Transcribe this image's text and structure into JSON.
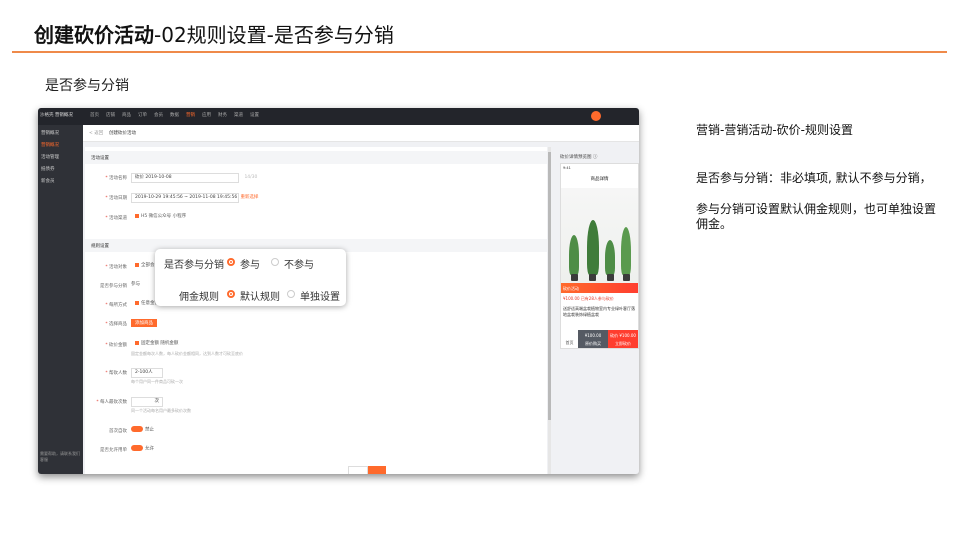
{
  "slide": {
    "title_bold": "创建砍价活动",
    "title_rest": "-02规则设置-是否参与分销",
    "section_label": "是否参与分销"
  },
  "screenshot": {
    "brand": "沙格壳 营销概况",
    "nav": [
      "首页",
      "店铺",
      "商品",
      "订单",
      "会员",
      "数据",
      "营销",
      "应用",
      "财务",
      "渠道",
      "设置"
    ],
    "nav_active_index": 6,
    "sidebar": [
      "营销概况",
      "营销概况",
      "活动管理",
      "抵债券",
      "新会员"
    ],
    "sidebar_active_index": 1,
    "sidebar_footer": "需要帮助，请联系我们客服",
    "crumb_back": "< 返回",
    "crumb_current": "创建砍价活动",
    "activity_section": "活动设置",
    "activity_rows": [
      {
        "label": "活动名称",
        "value": "砍价 2019-10-08"
      },
      {
        "label": "活动日期",
        "value": "2019-10-29 19:45:56 ~ 2019-11-08 19:45:56"
      },
      {
        "label": "活动渠道",
        "value": "H5  微信公众号  小程序"
      }
    ],
    "date_link": "重新选择",
    "name_counter": "14/30",
    "rules_section": "规则设置",
    "rule_rows": [
      {
        "label": "活动对象",
        "value": "全部会员"
      },
      {
        "label": "是否参与分销",
        "value": "参与"
      },
      {
        "label": "每所方式",
        "value": "任意金额可购买"
      },
      {
        "label": "选择商品",
        "value": "添加商品"
      },
      {
        "label": "砍价金额",
        "value": "固定金额    随机金额"
      },
      {
        "label": "帮砍人数",
        "value": "2-100人"
      },
      {
        "label": "每人最砍次数",
        "value": "次"
      },
      {
        "label": "首次自砍",
        "value": "禁止"
      },
      {
        "label": "是否允许用单",
        "value": "允许"
      }
    ],
    "rule_hints": [
      "固定金额每次人数，每人砍价金额相同，达到人数才可砍至底价",
      "每个用户同一件商品可砍一次",
      "同一个活动每名用户最多砍价次数"
    ],
    "preview_title": "砍价详情预览图 ⓘ",
    "phone": {
      "status": "9:41",
      "title": "商品详情",
      "banner": "砍价活动",
      "price": "¥100.00  已有28人参与砍价",
      "name": "送舒适高端盆栽植物室内专业绿叶客厅落地盆栽装饰绿植盆栽",
      "home": "首页",
      "btn1_price": "¥100.00",
      "btn1_label": "原价购买",
      "btn2_price": "砍价 ¥100.00",
      "btn2_label": "立即砍价"
    }
  },
  "zoom": {
    "row1_label": "是否参与分销",
    "row1_opt1": "参与",
    "row1_opt2": "不参与",
    "row2_label": "佣金规则",
    "row2_opt1": "默认规则",
    "row2_opt2": "单独设置"
  },
  "notes": {
    "breadcrumb": "营销-营销活动-砍价-规则设置",
    "line1": "是否参与分销：非必填项, 默认不参与分销，",
    "line2": "参与分销可设置默认佣金规则，也可单独设置佣金。"
  },
  "colors": {
    "accent": "#ff6a2c",
    "rule": "#ef8a4a",
    "nav": "#23252b"
  }
}
